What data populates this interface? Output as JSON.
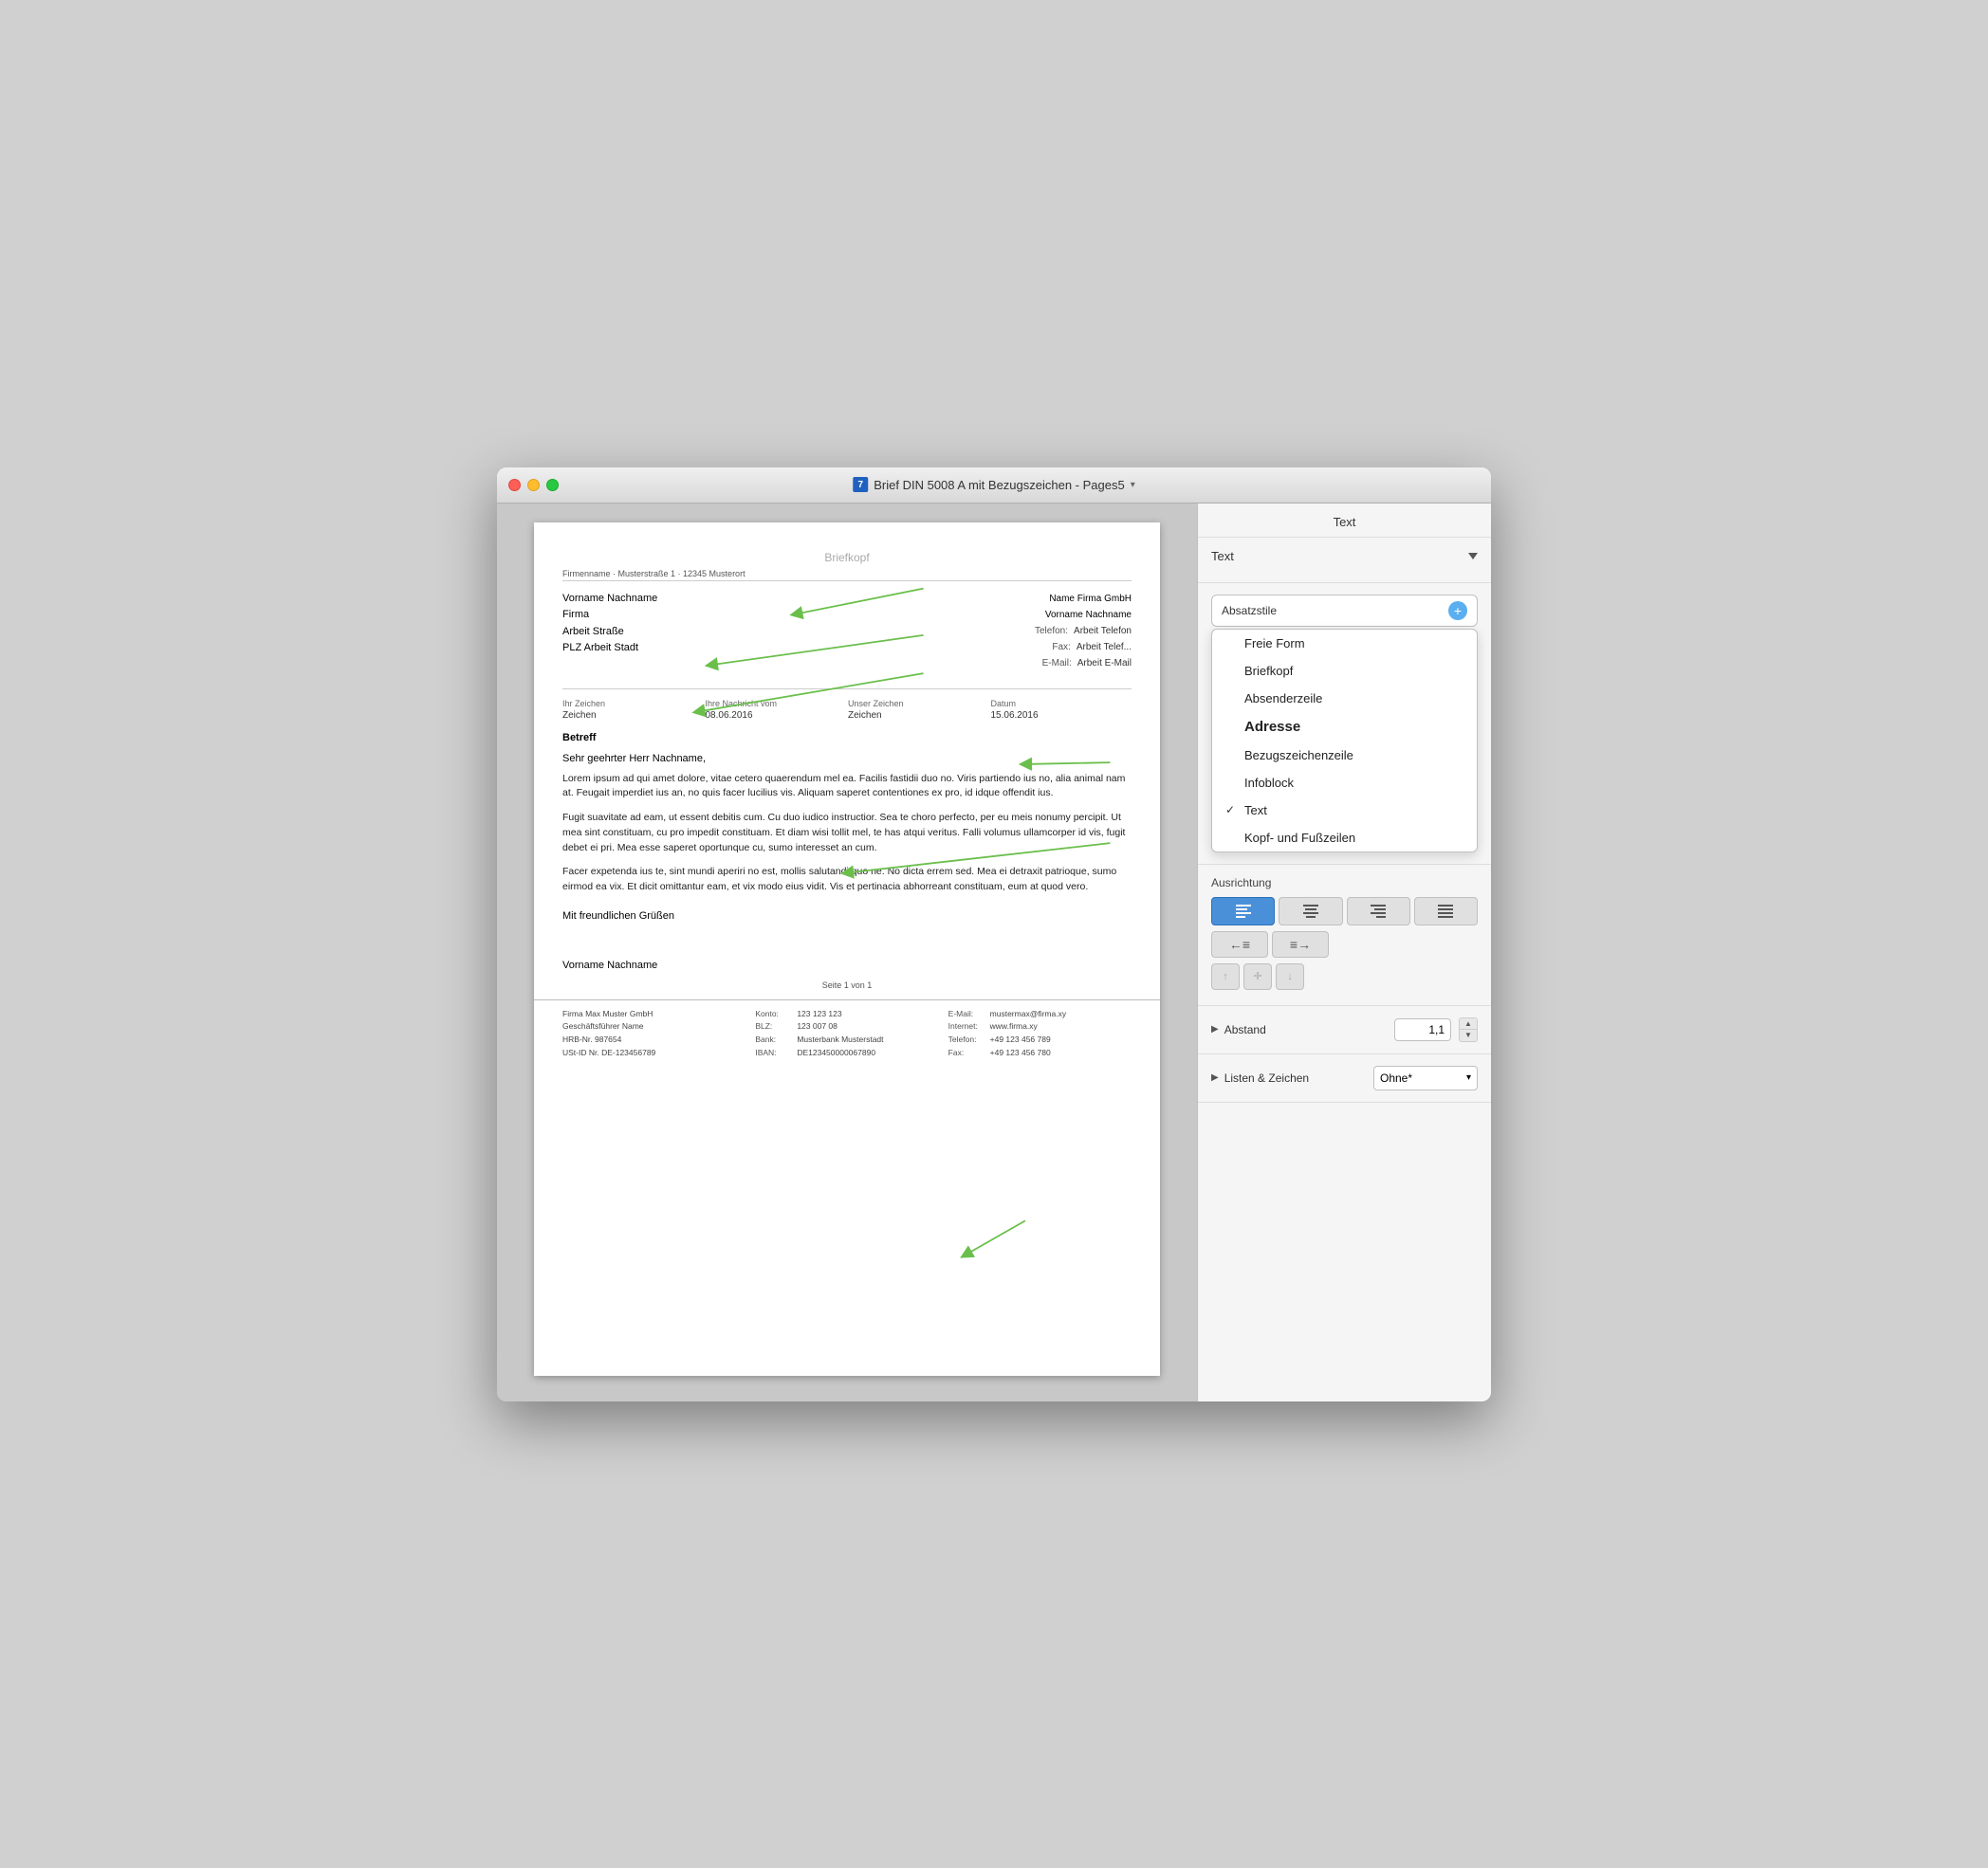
{
  "window": {
    "title": "Brief DIN 5008 A mit Bezugszeichen - Pages5",
    "title_icon": "7"
  },
  "panel": {
    "title": "Text",
    "text_style_label": "Text",
    "absatzstile_label": "Absatzstile",
    "plus_label": "+",
    "dropdown_items": [
      {
        "label": "Freie Form",
        "checked": false
      },
      {
        "label": "Briefkopf",
        "checked": false
      },
      {
        "label": "Absenderzeile",
        "checked": false
      },
      {
        "label": "Adresse",
        "checked": false
      },
      {
        "label": "Bezugszeichenzeile",
        "checked": false
      },
      {
        "label": "Infoblock",
        "checked": false
      },
      {
        "label": "Text",
        "checked": true
      },
      {
        "label": "Kopf- und Fußzeilen",
        "checked": false
      }
    ],
    "ausrichtung_label": "Ausrichtung",
    "align_buttons": [
      "≡",
      "≡",
      "≡",
      "≡"
    ],
    "abstand_label": "Abstand",
    "abstand_value": "1,1",
    "listen_label": "Listen & Zeichen",
    "listen_value": "Ohne*"
  },
  "document": {
    "briefkopf_placeholder": "Briefkopf",
    "absender_line": "Firmenname · Musterstraße 1 · 12345 Musterort",
    "address": {
      "name": "Vorname Nachname",
      "firma": "Firma",
      "strasse": "Arbeit Straße",
      "ort": "PLZ Arbeit Stadt"
    },
    "sender": {
      "company": "Name Firma GmbH",
      "contact": "Vorname Nachname",
      "telefon_label": "Telefon:",
      "telefon_val": "Arbeit Telefon",
      "fax_label": "Fax:",
      "fax_val": "Arbeit Telef...",
      "email_label": "E-Mail:",
      "email_val": "Arbeit E-Mail"
    },
    "bezugszeilen": [
      {
        "label": "Ihr Zeichen",
        "value": "Zeichen"
      },
      {
        "label": "Ihre Nachricht vom",
        "value": "08.06.2016"
      },
      {
        "label": "Unser Zeichen",
        "value": "Zeichen"
      },
      {
        "label": "Datum",
        "value": "15.06.2016"
      }
    ],
    "betreff": "Betreff",
    "salutation": "Sehr geehrter Herr Nachname,",
    "paragraphs": [
      "Lorem ipsum ad qui amet dolore, vitae cetero quaerendum mel ea. Facilis fastidii duo no. Viris partiendo ius no, alia animal nam at. Feugait imperdiet ius an, no quis facer lucilius vis. Aliquam saperet contentiones ex pro, id idque offendit ius.",
      "Fugit suavitate ad eam, ut essent debitis cum. Cu duo iudico instructior. Sea te choro perfecto, per eu meis nonumy percipit. Ut mea sint constituam, cu pro impedit constituam. Et diam wisi tollit mel, te has atqui veritus. Falli volumus ullamcorper id vis, fugit debet ei pri. Mea esse saperet oportunque cu, sumo interesset an cum.",
      "Facer expetenda ius te, sint mundi aperiri no est, mollis salutandi quo ne. No dicta errem sed. Mea ei detraxit patrioque, sumo eirmod ea vix. Et dicit omittantur eam, et vix modo eius vidit. Vis et pertinacia abhorreant constituam, eum at quod vero."
    ],
    "closing": "Mit freundlichen Grüßen",
    "signature": "Vorname Nachname",
    "page_number": "Seite 1 von 1",
    "footer": {
      "col1": {
        "line1": "Firma Max Muster GmbH",
        "line2": "Geschäftsführer Name",
        "line3": "HRB-Nr. 987654",
        "line4": "USt-ID Nr. DE-123456789"
      },
      "col2": {
        "konto_label": "Konto:",
        "konto_val": "123 123 123",
        "blz_label": "BLZ:",
        "blz_val": "123 007 08",
        "bank_label": "Bank:",
        "bank_val": "Musterbank Musterstadt",
        "iban_label": "IBAN:",
        "iban_val": "DE123450000067890"
      },
      "col3": {
        "email_label": "E-Mail:",
        "email_val": "mustermax@firma.xy",
        "internet_label": "Internet:",
        "internet_val": "www.firma.xy",
        "telefon_label": "Telefon:",
        "telefon_val": "+49 123 456 789",
        "fax_label": "Fax:",
        "fax_val": "+49 123 456 780"
      }
    }
  }
}
